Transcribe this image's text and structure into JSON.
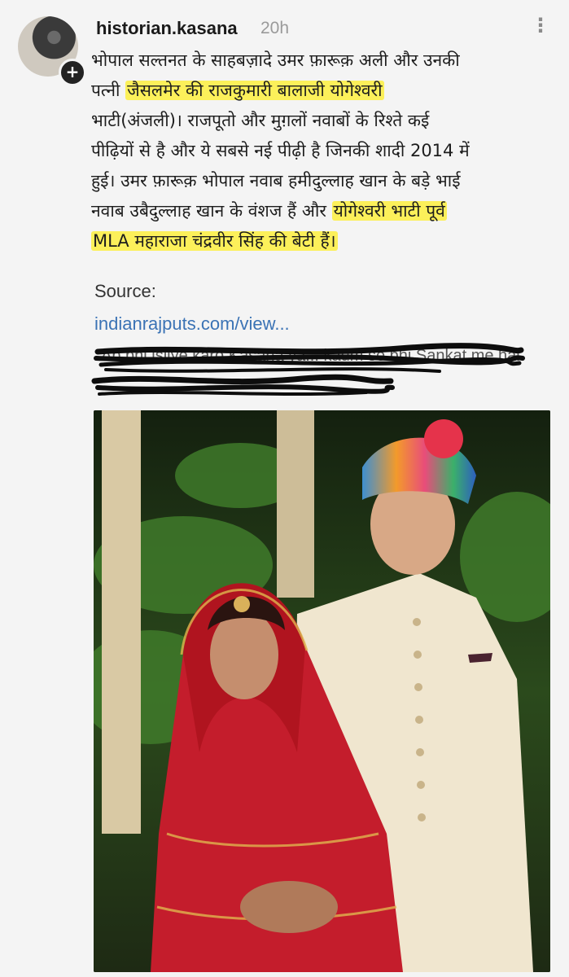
{
  "post": {
    "username": "historian.kasana",
    "timestamp": "20h",
    "more_label": "⋮",
    "avatar_plus": "+",
    "body_lines": [
      {
        "pre": "भोपाल सल्तनत के साहबज़ादे उमर फ़ारूक़ अली और उनकी",
        "hl": "",
        "post": ""
      },
      {
        "pre": "पत्नी ",
        "hl": "जैसलमेर की राजकुमारी बालाजी योगेश्वरी",
        "post": ""
      },
      {
        "pre": "भाटी(अंजली)। राजपूतो और मुग़लों नवाबों के रिश्ते कई",
        "hl": "",
        "post": ""
      },
      {
        "pre": "पीढ़ियों से है और ये सबसे नई पीढ़ी है जिनकी शादी 2014 में",
        "hl": "",
        "post": ""
      },
      {
        "pre": "हुई। उमर फ़ारूक़ भोपाल नवाब हमीदुल्लाह खान के बड़े भाई",
        "hl": "",
        "post": ""
      },
      {
        "pre": "नवाब उबैदुल्लाह खान के वंशज हैं और ",
        "hl": "योगेश्वरी भाटी पूर्व",
        "post": ""
      },
      {
        "pre": "",
        "hl": "MLA महाराजा चंद्रवीर सिंह की बेटी हैं।",
        "post": ""
      }
    ],
    "source_label": "Source:",
    "source_link": "indianrajputs.com/view...",
    "redacted_text": "Ab bhi isliye karo Kasana ya... kaum se bhi Sankat me hai",
    "photo_alt": "wedding couple photo"
  },
  "colors": {
    "highlight": "#fcf05a",
    "link": "#3b73b5",
    "timestamp": "#9a9a9a"
  }
}
